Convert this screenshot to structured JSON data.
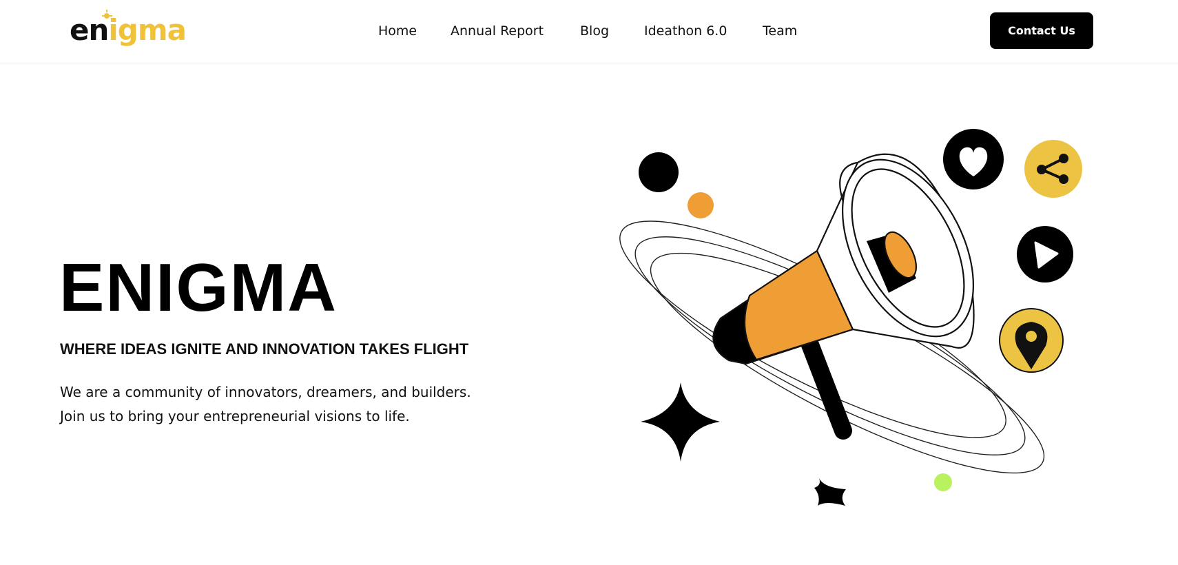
{
  "brand": {
    "logo_text_dark": "en",
    "logo_text_accent": "igma",
    "accent_color": "#f0c23a"
  },
  "nav": {
    "items": [
      {
        "label": "Home"
      },
      {
        "label": "Annual Report"
      },
      {
        "label": "Blog"
      },
      {
        "label": "Ideathon 6.0"
      },
      {
        "label": "Team"
      }
    ],
    "contact_label": "Contact Us"
  },
  "hero": {
    "title": "ENIGMA",
    "subtitle": "WHERE IDEAS IGNITE AND INNOVATION TAKES FLIGHT",
    "description_lines": [
      "We are a community of innovators, dreamers, and builders.",
      "Join us to bring your entrepreneurial visions to life."
    ]
  },
  "illustration": {
    "icons": [
      "megaphone-icon",
      "heart-icon",
      "share-icon",
      "play-icon",
      "location-pin-icon",
      "star-icon"
    ],
    "colors": {
      "orange": "#ef9d35",
      "yellow": "#edc344",
      "black": "#000000",
      "green": "#b9f25e"
    }
  }
}
